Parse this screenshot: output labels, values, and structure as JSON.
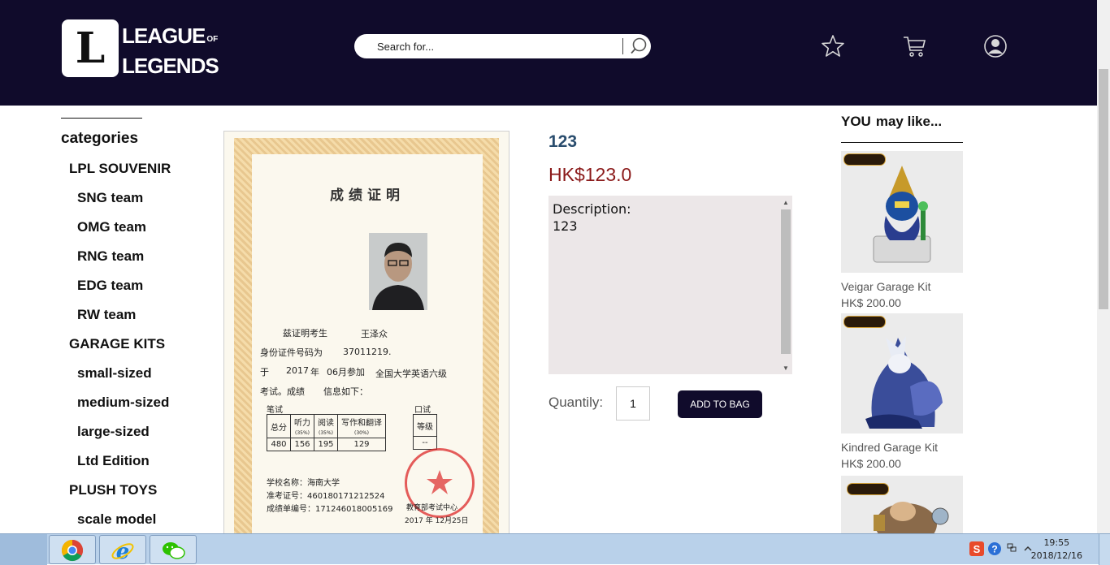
{
  "brand": {
    "line1": "LEAGUE",
    "of": "OF",
    "line2": "LEGENDS",
    "logo_letter": "L"
  },
  "header": {
    "search_placeholder": "Search for...",
    "icons": [
      "star-icon",
      "cart-icon",
      "user-icon"
    ]
  },
  "sidebar": {
    "title": "categories",
    "items": [
      {
        "label": "LPL SOUVENIR",
        "level": 1
      },
      {
        "label": "SNG team",
        "level": 2
      },
      {
        "label": "OMG team",
        "level": 2
      },
      {
        "label": "RNG team",
        "level": 2
      },
      {
        "label": "EDG team",
        "level": 2
      },
      {
        "label": "RW team",
        "level": 2
      },
      {
        "label": "GARAGE KITS",
        "level": 1
      },
      {
        "label": "small-sized",
        "level": 2
      },
      {
        "label": "medium-sized",
        "level": 2
      },
      {
        "label": "large-sized",
        "level": 2
      },
      {
        "label": "Ltd Edition",
        "level": 2
      },
      {
        "label": "PLUSH TOYS",
        "level": 1
      },
      {
        "label": "scale model",
        "level": 2
      }
    ]
  },
  "certificate": {
    "title": "成绩证明",
    "line1_prefix": "兹证明考生",
    "line1_name": "王泽众",
    "line2_prefix": "身份证件号码为",
    "line2_value": "37011219.",
    "line3_a": "于",
    "line3_year": "2017",
    "line3_b": "年",
    "line3_month": "06月参加",
    "line3_exam": "全国大学英语六级",
    "line4": "考试。成绩",
    "line4_b": "信息如下：",
    "written_label": "笔试",
    "oral_label": "口试",
    "headers": [
      "总分",
      "听力",
      "阅读",
      "写作和翻译",
      "等级"
    ],
    "weights": [
      "",
      "(35%)",
      "(35%)",
      "(30%)",
      ""
    ],
    "scores": [
      "480",
      "156",
      "195",
      "129",
      "--"
    ],
    "school": "学校名称：海南大学",
    "ticket": "准考证号：460180171212524",
    "report_no": "成绩单编号：171246018005169",
    "issuer": "教育部考试中心",
    "issue_date": "2017 年 12月25日"
  },
  "product": {
    "name": "123",
    "price": "HK$123.0",
    "description_label": "Description:",
    "description": "123",
    "quantity_label": "Quantily:",
    "quantity": "1",
    "add_button": "ADD TO BAG"
  },
  "recommendations": {
    "title_a": "YOU",
    "title_b": "may like...",
    "items": [
      {
        "name": "Veigar Garage Kit",
        "price": "HK$ 200.00"
      },
      {
        "name": "Kindred Garage Kit",
        "price": "HK$ 200.00"
      },
      {
        "name": "",
        "price": ""
      }
    ]
  },
  "taskbar": {
    "apps": [
      "chrome-icon",
      "internet-explorer-icon",
      "wechat-icon"
    ],
    "time": "19:55",
    "date": "2018/12/16"
  },
  "colors": {
    "header_bg": "#100b2b",
    "product_name": "#2a4d6e",
    "price": "#8b1a1a",
    "desc_bg": "#ece7e8",
    "button_bg": "#100b2b"
  }
}
